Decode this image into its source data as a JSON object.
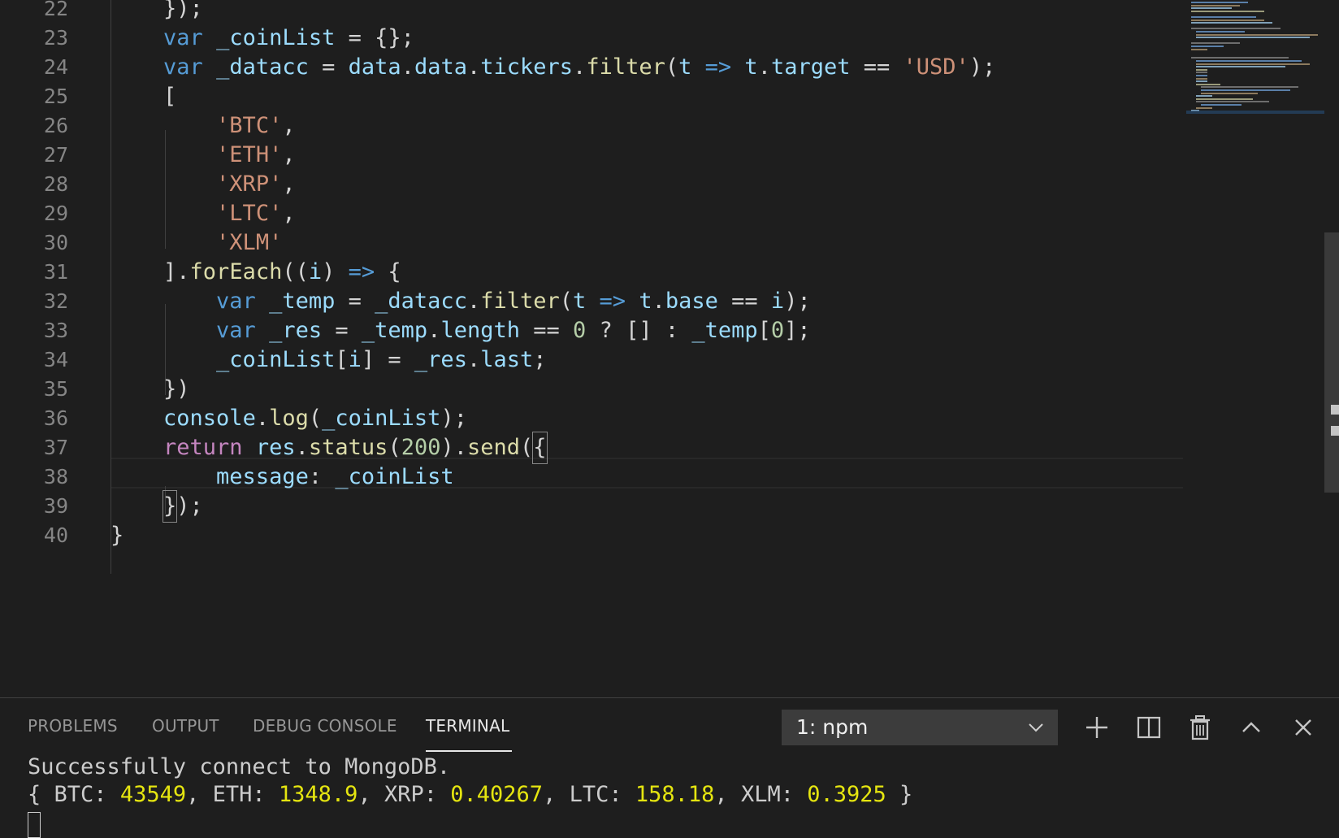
{
  "editor": {
    "lines": [
      {
        "n": "22",
        "tokens": [
          {
            "t": "    });",
            "c": "op"
          }
        ]
      },
      {
        "n": "23",
        "tokens": [
          {
            "t": "    ",
            "c": "op"
          },
          {
            "t": "var",
            "c": "kw"
          },
          {
            "t": " ",
            "c": "op"
          },
          {
            "t": "_coinList",
            "c": "var"
          },
          {
            "t": " = {};",
            "c": "op"
          }
        ]
      },
      {
        "n": "24",
        "tokens": [
          {
            "t": "    ",
            "c": "op"
          },
          {
            "t": "var",
            "c": "kw"
          },
          {
            "t": " ",
            "c": "op"
          },
          {
            "t": "_datacc",
            "c": "var"
          },
          {
            "t": " = ",
            "c": "op"
          },
          {
            "t": "data",
            "c": "var"
          },
          {
            "t": ".",
            "c": "op"
          },
          {
            "t": "data",
            "c": "var"
          },
          {
            "t": ".",
            "c": "op"
          },
          {
            "t": "tickers",
            "c": "var"
          },
          {
            "t": ".",
            "c": "op"
          },
          {
            "t": "filter",
            "c": "fn"
          },
          {
            "t": "(",
            "c": "op"
          },
          {
            "t": "t",
            "c": "var"
          },
          {
            "t": " => ",
            "c": "kw"
          },
          {
            "t": "t",
            "c": "var"
          },
          {
            "t": ".",
            "c": "op"
          },
          {
            "t": "target",
            "c": "var"
          },
          {
            "t": " == ",
            "c": "op"
          },
          {
            "t": "'USD'",
            "c": "str"
          },
          {
            "t": ");",
            "c": "op"
          }
        ]
      },
      {
        "n": "25",
        "tokens": [
          {
            "t": "    [",
            "c": "op"
          }
        ]
      },
      {
        "n": "26",
        "tokens": [
          {
            "t": "        ",
            "c": "op"
          },
          {
            "t": "'BTC'",
            "c": "str"
          },
          {
            "t": ",",
            "c": "op"
          }
        ]
      },
      {
        "n": "27",
        "tokens": [
          {
            "t": "        ",
            "c": "op"
          },
          {
            "t": "'ETH'",
            "c": "str"
          },
          {
            "t": ",",
            "c": "op"
          }
        ]
      },
      {
        "n": "28",
        "tokens": [
          {
            "t": "        ",
            "c": "op"
          },
          {
            "t": "'XRP'",
            "c": "str"
          },
          {
            "t": ",",
            "c": "op"
          }
        ]
      },
      {
        "n": "29",
        "tokens": [
          {
            "t": "        ",
            "c": "op"
          },
          {
            "t": "'LTC'",
            "c": "str"
          },
          {
            "t": ",",
            "c": "op"
          }
        ]
      },
      {
        "n": "30",
        "tokens": [
          {
            "t": "        ",
            "c": "op"
          },
          {
            "t": "'XLM'",
            "c": "str"
          }
        ]
      },
      {
        "n": "31",
        "tokens": [
          {
            "t": "    ].",
            "c": "op"
          },
          {
            "t": "forEach",
            "c": "fn"
          },
          {
            "t": "((",
            "c": "op"
          },
          {
            "t": "i",
            "c": "var"
          },
          {
            "t": ")",
            "c": "op"
          },
          {
            "t": " => ",
            "c": "kw"
          },
          {
            "t": "{",
            "c": "op"
          }
        ]
      },
      {
        "n": "32",
        "tokens": [
          {
            "t": "        ",
            "c": "op"
          },
          {
            "t": "var",
            "c": "kw"
          },
          {
            "t": " ",
            "c": "op"
          },
          {
            "t": "_temp",
            "c": "var"
          },
          {
            "t": " = ",
            "c": "op"
          },
          {
            "t": "_datacc",
            "c": "var"
          },
          {
            "t": ".",
            "c": "op"
          },
          {
            "t": "filter",
            "c": "fn"
          },
          {
            "t": "(",
            "c": "op"
          },
          {
            "t": "t",
            "c": "var"
          },
          {
            "t": " => ",
            "c": "kw"
          },
          {
            "t": "t",
            "c": "var"
          },
          {
            "t": ".",
            "c": "op"
          },
          {
            "t": "base",
            "c": "var"
          },
          {
            "t": " == ",
            "c": "op"
          },
          {
            "t": "i",
            "c": "var"
          },
          {
            "t": ");",
            "c": "op"
          }
        ]
      },
      {
        "n": "33",
        "tokens": [
          {
            "t": "        ",
            "c": "op"
          },
          {
            "t": "var",
            "c": "kw"
          },
          {
            "t": " ",
            "c": "op"
          },
          {
            "t": "_res",
            "c": "var"
          },
          {
            "t": " = ",
            "c": "op"
          },
          {
            "t": "_temp",
            "c": "var"
          },
          {
            "t": ".",
            "c": "op"
          },
          {
            "t": "length",
            "c": "var"
          },
          {
            "t": " == ",
            "c": "op"
          },
          {
            "t": "0",
            "c": "num"
          },
          {
            "t": " ? [] : ",
            "c": "op"
          },
          {
            "t": "_temp",
            "c": "var"
          },
          {
            "t": "[",
            "c": "op"
          },
          {
            "t": "0",
            "c": "num"
          },
          {
            "t": "];",
            "c": "op"
          }
        ]
      },
      {
        "n": "34",
        "tokens": [
          {
            "t": "        ",
            "c": "op"
          },
          {
            "t": "_coinList",
            "c": "var"
          },
          {
            "t": "[",
            "c": "op"
          },
          {
            "t": "i",
            "c": "var"
          },
          {
            "t": "] = ",
            "c": "op"
          },
          {
            "t": "_res",
            "c": "var"
          },
          {
            "t": ".",
            "c": "op"
          },
          {
            "t": "last",
            "c": "var"
          },
          {
            "t": ";",
            "c": "op"
          }
        ]
      },
      {
        "n": "35",
        "tokens": [
          {
            "t": "    })",
            "c": "op"
          }
        ]
      },
      {
        "n": "36",
        "tokens": [
          {
            "t": "    ",
            "c": "op"
          },
          {
            "t": "console",
            "c": "var"
          },
          {
            "t": ".",
            "c": "op"
          },
          {
            "t": "log",
            "c": "fn"
          },
          {
            "t": "(",
            "c": "op"
          },
          {
            "t": "_coinList",
            "c": "var"
          },
          {
            "t": ");",
            "c": "op"
          }
        ]
      },
      {
        "n": "37",
        "tokens": [
          {
            "t": "    ",
            "c": "op"
          },
          {
            "t": "return",
            "c": "kw2"
          },
          {
            "t": " ",
            "c": "op"
          },
          {
            "t": "res",
            "c": "var"
          },
          {
            "t": ".",
            "c": "op"
          },
          {
            "t": "status",
            "c": "fn"
          },
          {
            "t": "(",
            "c": "op"
          },
          {
            "t": "200",
            "c": "num"
          },
          {
            "t": ").",
            "c": "op"
          },
          {
            "t": "send",
            "c": "fn"
          },
          {
            "t": "(",
            "c": "op"
          },
          {
            "t": "{",
            "c": "box"
          }
        ]
      },
      {
        "n": "38",
        "tokens": [
          {
            "t": "        ",
            "c": "op"
          },
          {
            "t": "message",
            "c": "var"
          },
          {
            "t": ": ",
            "c": "op"
          },
          {
            "t": "_coinList",
            "c": "var"
          }
        ]
      },
      {
        "n": "39",
        "tokens": [
          {
            "t": "    ",
            "c": "op"
          },
          {
            "t": "}",
            "c": "box"
          },
          {
            "t": ");",
            "c": "op"
          }
        ]
      },
      {
        "n": "40",
        "tokens": [
          {
            "t": "}",
            "c": "op"
          }
        ]
      }
    ]
  },
  "panel": {
    "tabs": [
      {
        "id": "problems",
        "label": "PROBLEMS"
      },
      {
        "id": "output",
        "label": "OUTPUT"
      },
      {
        "id": "debug",
        "label": "DEBUG CONSOLE"
      },
      {
        "id": "terminal",
        "label": "TERMINAL"
      }
    ],
    "terminal_selector": "1: npm",
    "terminal_output": {
      "line1": "Successfully connect to MongoDB.",
      "coins": [
        {
          "k": "BTC",
          "v": "43549"
        },
        {
          "k": "ETH",
          "v": "1348.9"
        },
        {
          "k": "XRP",
          "v": "0.40267"
        },
        {
          "k": "LTC",
          "v": "158.18"
        },
        {
          "k": "XLM",
          "v": "0.3925"
        }
      ]
    }
  },
  "colors": {
    "keyword": "#569cd6",
    "control": "#c586c0",
    "variable": "#9cdcfe",
    "function": "#dcdcaa",
    "string": "#ce9178",
    "number": "#b5cea8",
    "terminal_number": "#e5e510"
  }
}
